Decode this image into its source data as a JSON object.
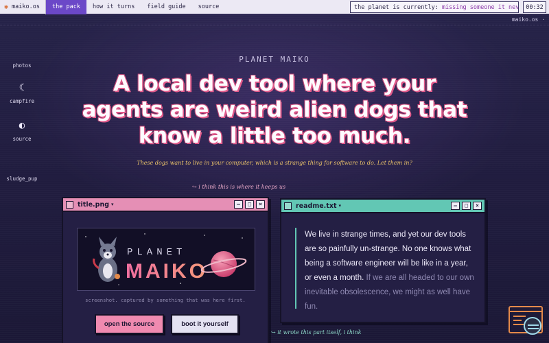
{
  "menubar": {
    "brand_icon": "asterisk-icon",
    "brand": "maiko.os",
    "nav": [
      {
        "label": "the pack",
        "active": true
      },
      {
        "label": "how it turns",
        "active": false
      },
      {
        "label": "field guide",
        "active": false
      },
      {
        "label": "source",
        "active": false
      }
    ],
    "status_label": "the planet is currently:",
    "status_value": "missing someone it never met",
    "clock": "00:32"
  },
  "ticker": "maiko.os · ",
  "desktop_icons": [
    {
      "label": "photos",
      "icon": "photos-icon",
      "glyph": ""
    },
    {
      "label": "campfire",
      "icon": "moon-icon",
      "glyph": "☾"
    },
    {
      "label": "source",
      "icon": "half-circle-icon",
      "glyph": "◐"
    },
    {
      "label": "sludge_pup",
      "icon": "pup-icon",
      "glyph": ""
    }
  ],
  "hero": {
    "eyebrow": "PLANET MAIKO",
    "headline": "A local dev tool where your agents are weird alien dogs that know a little too much.",
    "tagline": "These dogs want to live in your computer, which is a strange thing for software to do. Let them in?"
  },
  "notes": {
    "top": "↪ i think this is where it keeps us",
    "bottom": "↪ it wrote this part itself, i think"
  },
  "window_left": {
    "title": "title.png",
    "caret": "▾",
    "controls": [
      "–",
      "□",
      "×"
    ],
    "banner_line1": "PLANET",
    "banner_line2": "MAIKO",
    "caption": "screenshot. captured by something that was here first.",
    "primary_button": "open the source",
    "secondary_button": "boot it yourself"
  },
  "window_right": {
    "title": "readme.txt",
    "caret": "▾",
    "controls": [
      "–",
      "□",
      "×"
    ],
    "body_main": "We live in strange times, and yet our dev tools are so painfully un-strange. No one knows what being a software engineer will be like in a year, or even a month.",
    "body_muted": "If we are all headed to our own inevitable obsolescence, we might as well have fun."
  },
  "colors": {
    "accent_purple": "#6b48c8",
    "pink": "#e58fb5",
    "teal": "#62c7b4",
    "gold_text": "#e7c06a",
    "background": "#221e42"
  }
}
